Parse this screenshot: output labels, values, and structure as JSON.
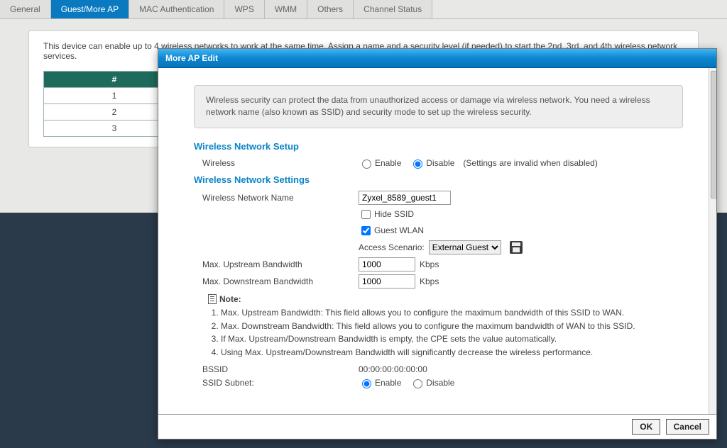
{
  "tabs": {
    "items": [
      {
        "label": "General"
      },
      {
        "label": "Guest/More AP"
      },
      {
        "label": "MAC Authentication"
      },
      {
        "label": "WPS"
      },
      {
        "label": "WMM"
      },
      {
        "label": "Others"
      },
      {
        "label": "Channel Status"
      }
    ],
    "active_index": 1
  },
  "background": {
    "intro": "This device can enable up to 4 wireless networks to work at the same time. Assign a name and a security level (if needed) to start the 2nd, 3rd, and 4th wireless network services.",
    "col_header": "#",
    "rows": [
      "1",
      "2",
      "3"
    ]
  },
  "modal": {
    "title": "More AP Edit",
    "help": "Wireless security can protect the data from unauthorized access or damage via wireless network. You need a wireless network name (also known as SSID) and security mode to set up the wireless security.",
    "section_setup": "Wireless Network Setup",
    "wireless_label": "Wireless",
    "enable_label": "Enable",
    "disable_label": "Disable",
    "disabled_note": "(Settings are invalid when disabled)",
    "section_settings": "Wireless Network Settings",
    "wname_label": "Wireless Network Name",
    "wname_value": "Zyxel_8589_guest1",
    "hide_ssid_label": "Hide SSID",
    "guest_wlan_label": "Guest WLAN",
    "access_scenario_label": "Access Scenario:",
    "access_scenario_value": "External Guest",
    "up_bw_label": "Max. Upstream Bandwidth",
    "up_bw_value": "1000",
    "down_bw_label": "Max. Downstream Bandwidth",
    "down_bw_value": "1000",
    "kbps": "Kbps",
    "note_title": "Note:",
    "notes": [
      "Max. Upstream Bandwidth: This field allows you to configure the maximum bandwidth of this SSID to WAN.",
      "Max. Downstream Bandwidth: This field allows you to configure the maximum bandwidth of WAN to this SSID.",
      "If Max. Upstream/Downstream Bandwidth is empty, the CPE sets the value automatically.",
      "Using Max. Upstream/Downstream Bandwidth will significantly decrease the wireless performance."
    ],
    "bssid_label": "BSSID",
    "bssid_value": "00:00:00:00:00:00",
    "ssid_subnet_label": "SSID Subnet:",
    "ok": "OK",
    "cancel": "Cancel"
  }
}
